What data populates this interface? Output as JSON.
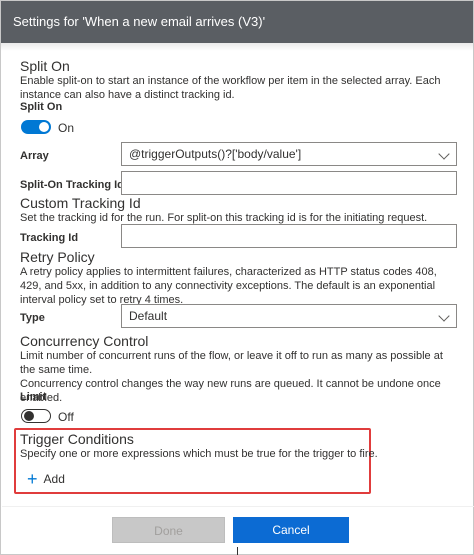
{
  "dialog": {
    "title": "Settings for 'When a new email arrives (V3)'"
  },
  "split_on": {
    "heading": "Split On",
    "description": "Enable split-on to start an instance of the workflow per item in the selected array. Each instance can also have a distinct tracking id.",
    "toggle_label": "Split On",
    "toggle_state": "On",
    "array_label": "Array",
    "array_value": "@triggerOutputs()?['body/value']",
    "tracking_label": "Split-On Tracking Id",
    "tracking_value": ""
  },
  "custom_tracking": {
    "heading": "Custom Tracking Id",
    "description": "Set the tracking id for the run. For split-on this tracking id is for the initiating request.",
    "label": "Tracking Id",
    "value": ""
  },
  "retry_policy": {
    "heading": "Retry Policy",
    "description": "A retry policy applies to intermittent failures, characterized as HTTP status codes 408, 429, and 5xx, in addition to any connectivity exceptions. The default is an exponential interval policy set to retry 4 times.",
    "type_label": "Type",
    "type_value": "Default"
  },
  "concurrency": {
    "heading": "Concurrency Control",
    "description1": "Limit number of concurrent runs of the flow, or leave it off to run as many as possible at the same time.",
    "description2": "Concurrency control changes the way new runs are queued. It cannot be undone once enabled.",
    "limit_label": "Limit",
    "toggle_state": "Off"
  },
  "trigger_conditions": {
    "heading": "Trigger Conditions",
    "description": "Specify one or more expressions which must be true for the trigger to fire.",
    "add_label": "Add"
  },
  "footer": {
    "done_label": "Done",
    "cancel_label": "Cancel"
  },
  "colors": {
    "accent": "#0078d4",
    "titlebar": "#5a5e63",
    "highlight": "#e03c3c"
  }
}
